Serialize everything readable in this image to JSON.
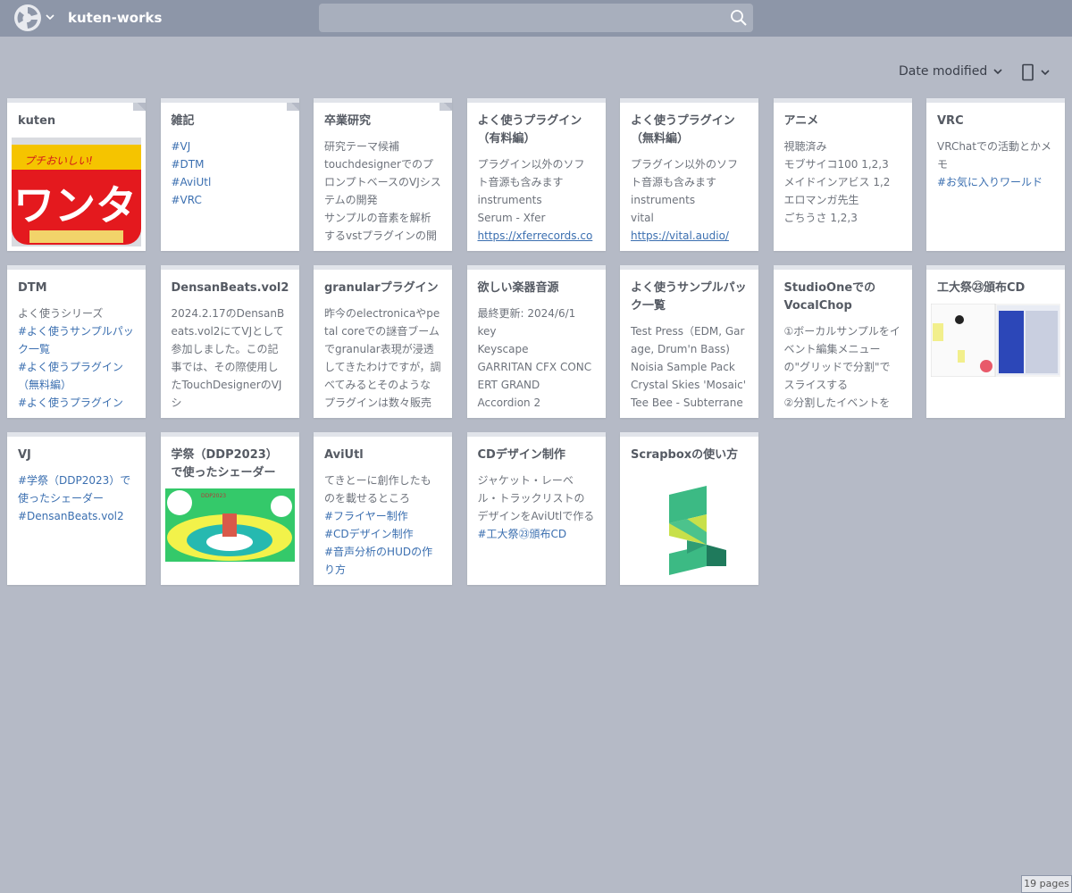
{
  "header": {
    "project_title": "kuten-works",
    "search_placeholder": "",
    "logo_icon": "scrapbox-logo-icon",
    "caret_icon": "chevron-down-icon",
    "search_icon": "search-icon"
  },
  "toolbar": {
    "sort_label": "Date modified",
    "sort_icon": "chevron-down-icon",
    "view_icon": "grid-view-icon"
  },
  "cards": [
    {
      "title": "kuten",
      "lines": [],
      "image": "kuten-photo",
      "pinned": true
    },
    {
      "title": "雑記",
      "lines": [
        {
          "text": "#VJ",
          "kind": "tag"
        },
        {
          "text": "#DTM",
          "kind": "tag"
        },
        {
          "text": "#AviUtl",
          "kind": "tag"
        },
        {
          "text": "#VRC",
          "kind": "tag"
        }
      ],
      "pinned": true
    },
    {
      "title": "卒業研究",
      "lines": [
        {
          "text": "研究テーマ候補",
          "kind": "text"
        },
        {
          "text": "touchdesignerでのプロンプトベースのVJシステムの開発",
          "kind": "text"
        },
        {
          "text": "サンプルの音素を解析するvstプラグインの開",
          "kind": "text"
        }
      ],
      "pinned": true
    },
    {
      "title": "よく使うプラグイン（有料編）",
      "lines": [
        {
          "text": "プラグイン以外のソフト音源も含みます",
          "kind": "text"
        },
        {
          "text": "instruments",
          "kind": "text"
        },
        {
          "text": "Serum - Xfer",
          "kind": "text"
        },
        {
          "text": "https://xferrecords.co",
          "kind": "url"
        }
      ]
    },
    {
      "title": "よく使うプラグイン（無料編）",
      "lines": [
        {
          "text": "プラグイン以外のソフト音源も含みます",
          "kind": "text"
        },
        {
          "text": "instruments",
          "kind": "text"
        },
        {
          "text": "vital",
          "kind": "text"
        },
        {
          "text": "https://vital.audio/",
          "kind": "url"
        }
      ]
    },
    {
      "title": "アニメ",
      "lines": [
        {
          "text": "視聴済み",
          "kind": "text"
        },
        {
          "text": "モブサイコ100 1,2,3",
          "kind": "text"
        },
        {
          "text": "メイドインアビス 1,2",
          "kind": "text"
        },
        {
          "text": "エロマンガ先生",
          "kind": "text"
        },
        {
          "text": "ごちうさ 1,2,3",
          "kind": "text"
        }
      ]
    },
    {
      "title": "VRC",
      "lines": [
        {
          "text": "VRChatでの活動とかメモ",
          "kind": "text"
        },
        {
          "text": "#お気に入りワールド",
          "kind": "tag"
        }
      ]
    },
    {
      "title": "DTM",
      "lines": [
        {
          "text": "よく使うシリーズ",
          "kind": "text"
        },
        {
          "text": "#よく使うサンプルパック一覧",
          "kind": "tag"
        },
        {
          "text": "#よく使うプラグイン（無料編）",
          "kind": "tag"
        },
        {
          "text": "#よく使うプラグイン",
          "kind": "tag"
        }
      ]
    },
    {
      "title": "DensanBeats.vol2",
      "lines": [
        {
          "text": "2024.2.17のDensanBeats.vol2にてVJとして参加しました。この記事では、その際使用したTouchDesignerのVJシ",
          "kind": "text"
        }
      ]
    },
    {
      "title": "granularプラグイン",
      "lines": [
        {
          "text": "昨今のelectronicaやpetal coreでの謎音ブームでgranular表現が浸透してきたわけですが，調べてみるとそのようなプラグインは数々販売さ",
          "kind": "text"
        }
      ]
    },
    {
      "title": "欲しい楽器音源",
      "lines": [
        {
          "text": "最終更新: 2024/6/1",
          "kind": "text"
        },
        {
          "text": "key",
          "kind": "text"
        },
        {
          "text": "Keyscape",
          "kind": "text"
        },
        {
          "text": "GARRITAN CFX CONCERT GRAND",
          "kind": "text"
        },
        {
          "text": "Accordion 2",
          "kind": "text"
        }
      ]
    },
    {
      "title": "よく使うサンプルパック一覧",
      "lines": [
        {
          "text": "Test Press（EDM, Garage, Drum'n Bass)",
          "kind": "text"
        },
        {
          "text": "Noisia Sample Pack",
          "kind": "text"
        },
        {
          "text": "Crystal Skies 'Mosaic'",
          "kind": "text"
        },
        {
          "text": "Tee Bee - Subterranean",
          "kind": "text"
        }
      ]
    },
    {
      "title": "StudioOneでのVocalChop",
      "lines": [
        {
          "text": "①ボーカルサンプルをイベント編集メニューの\"グリッドで分割\"でスライスする",
          "kind": "text"
        },
        {
          "text": "②分割したイベントを",
          "kind": "text"
        }
      ]
    },
    {
      "title": "工大祭㉓頒布CD",
      "lines": [],
      "image": "cd-screenshot"
    },
    {
      "title": "VJ",
      "lines": [
        {
          "text": "#学祭（DDP2023）で使ったシェーダー",
          "kind": "tag"
        },
        {
          "text": "#DensanBeats.vol2",
          "kind": "tag"
        }
      ]
    },
    {
      "title": "学祭（DDP2023）で使ったシェーダー",
      "lines": [],
      "image": "shader-screenshot"
    },
    {
      "title": "AviUtl",
      "lines": [
        {
          "text": "てきとーに創作したものを載せるところ",
          "kind": "text"
        },
        {
          "text": "#フライヤー制作",
          "kind": "tag"
        },
        {
          "text": "#CDデザイン制作",
          "kind": "tag"
        },
        {
          "text": "#音声分析のHUDの作り方",
          "kind": "tag"
        }
      ]
    },
    {
      "title": "CDデザイン制作",
      "lines": [
        {
          "text": "ジャケット・レーベル・トラックリストのデザインをAviUtlで作る",
          "kind": "text"
        },
        {
          "text": "#工大祭㉓頒布CD",
          "kind": "tag"
        }
      ]
    },
    {
      "title": "Scrapboxの使い方",
      "lines": [],
      "image": "scrapbox-logo"
    }
  ],
  "footer": {
    "page_count": "19 pages"
  },
  "colors": {
    "background": "#b5bac6",
    "navbar": "#8d96a8",
    "tag_link": "#3b6fb0",
    "card": "#ffffff"
  }
}
